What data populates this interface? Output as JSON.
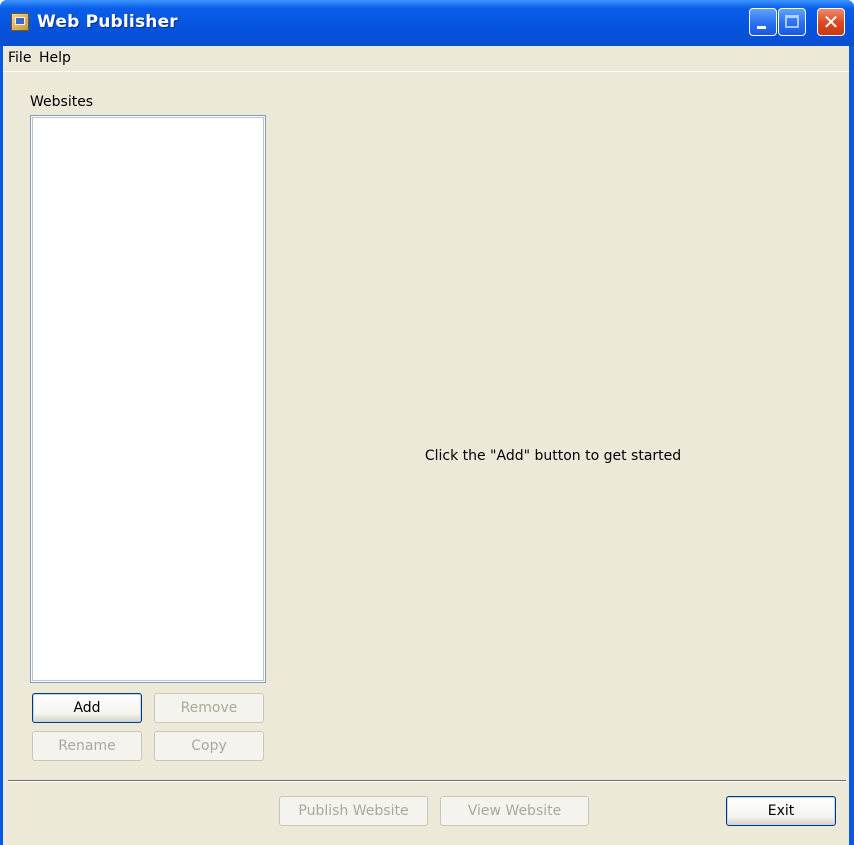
{
  "window": {
    "title": "Web Publisher",
    "controls": {
      "minimize": "minimize",
      "maximize": "maximize",
      "close": "✕"
    }
  },
  "menubar": {
    "items": [
      {
        "label": "File"
      },
      {
        "label": "Help"
      }
    ]
  },
  "sidebar": {
    "label": "Websites",
    "list_items": [],
    "buttons": {
      "add": "Add",
      "remove": "Remove",
      "rename": "Rename",
      "copy": "Copy"
    }
  },
  "main": {
    "hint": "Click the \"Add\" button to get started"
  },
  "footer": {
    "publish": "Publish Website",
    "view": "View Website",
    "exit": "Exit"
  },
  "colors": {
    "titlebar": "#0553dd",
    "client_bg": "#ece9d8",
    "disabled_text": "#aca899"
  },
  "icons": {
    "app": "web-publisher-app-icon"
  }
}
